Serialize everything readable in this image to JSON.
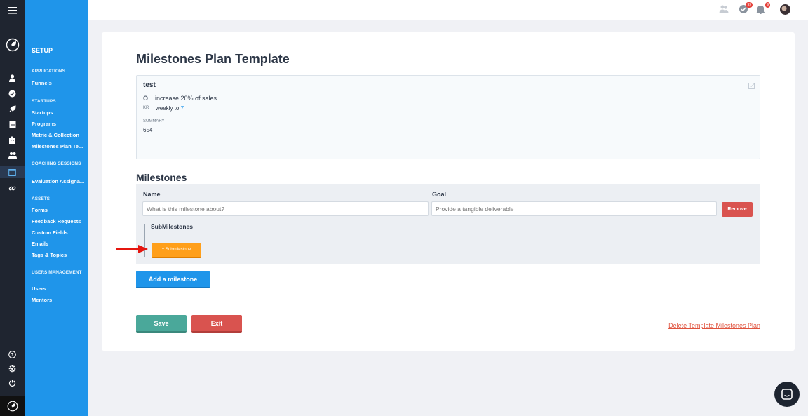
{
  "sidebar": {
    "setup_label": "SETUP",
    "sections": [
      {
        "label": "APPLICATIONS"
      },
      {
        "label": "STARTUPS"
      },
      {
        "label": "COACHING SESSIONS"
      },
      {
        "label": "ASSETS"
      },
      {
        "label": "USERS MANAGEMENT"
      }
    ],
    "items": [
      {
        "label": "Funnels"
      },
      {
        "label": "Startups"
      },
      {
        "label": "Programs"
      },
      {
        "label": "Metric & Collection"
      },
      {
        "label": "Milestones Plan Te..."
      },
      {
        "label": "Evaluation Assigna..."
      },
      {
        "label": "Forms"
      },
      {
        "label": "Feedback Requests"
      },
      {
        "label": "Custom Fields"
      },
      {
        "label": "Emails"
      },
      {
        "label": "Tags & Topics"
      },
      {
        "label": "Users"
      },
      {
        "label": "Mentors"
      }
    ]
  },
  "topbar": {
    "badges": {
      "tasks": "99",
      "notifications": "9"
    }
  },
  "page": {
    "title": "Milestones Plan Template",
    "okr": {
      "title": "test",
      "objective_marker": "O",
      "objective": "increase 20% of sales",
      "kr_marker": "KR",
      "kr_text": "weekly to",
      "kr_value": "7",
      "summary_label": "SUMMARY",
      "summary_value": "654"
    },
    "milestones_heading": "Milestones",
    "milestone": {
      "name_label": "Name",
      "goal_label": "Goal",
      "name_placeholder": "What is this milestone about?",
      "goal_placeholder": "Provide a tangible deliverable",
      "remove_label": "Remove",
      "submilestones_label": "SubMilestones",
      "add_submilestone_label": "+ Submilestone"
    },
    "add_milestone_label": "Add a milestone",
    "save_label": "Save",
    "exit_label": "Exit",
    "delete_label": "Delete Template Milestones Plan"
  },
  "colors": {
    "sidebar_blue": "#1f95ea",
    "rail_dark": "#1f2530",
    "save_green": "#4aa89a",
    "danger_red": "#d9534f",
    "submilestone_orange": "#ff9f1a"
  }
}
